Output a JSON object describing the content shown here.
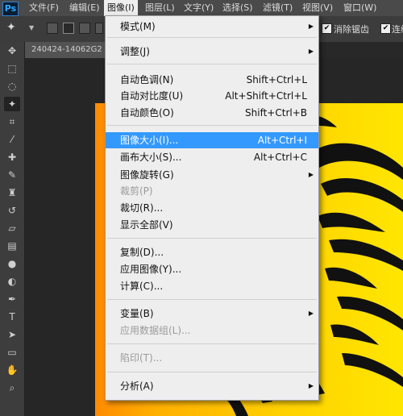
{
  "app": {
    "logo": "Ps"
  },
  "menubar": {
    "items": [
      {
        "label": "文件(F)"
      },
      {
        "label": "编辑(E)"
      },
      {
        "label": "图像(I)"
      },
      {
        "label": "图层(L)"
      },
      {
        "label": "文字(Y)"
      },
      {
        "label": "选择(S)"
      },
      {
        "label": "滤镜(T)"
      },
      {
        "label": "视图(V)"
      },
      {
        "label": "窗口(W)"
      }
    ],
    "active_index": 2
  },
  "options_bar": {
    "antialias_label": "消除锯齿",
    "antialias_checked": true,
    "contiguous_label": "连续",
    "contiguous_checked": true,
    "check_mark": "✔"
  },
  "document": {
    "tab_label": "240424-14062G2"
  },
  "image_menu": {
    "items": [
      {
        "label": "模式(M)",
        "shortcut": "",
        "submenu": true,
        "disabled": false
      },
      {
        "sep": true
      },
      {
        "label": "调整(J)",
        "shortcut": "",
        "submenu": true,
        "disabled": false
      },
      {
        "sep": true
      },
      {
        "label": "自动色调(N)",
        "shortcut": "Shift+Ctrl+L",
        "submenu": false,
        "disabled": false
      },
      {
        "label": "自动对比度(U)",
        "shortcut": "Alt+Shift+Ctrl+L",
        "submenu": false,
        "disabled": false
      },
      {
        "label": "自动颜色(O)",
        "shortcut": "Shift+Ctrl+B",
        "submenu": false,
        "disabled": false
      },
      {
        "sep": true
      },
      {
        "label": "图像大小(I)...",
        "shortcut": "Alt+Ctrl+I",
        "submenu": false,
        "disabled": false,
        "highlighted": true
      },
      {
        "label": "画布大小(S)...",
        "shortcut": "Alt+Ctrl+C",
        "submenu": false,
        "disabled": false
      },
      {
        "label": "图像旋转(G)",
        "shortcut": "",
        "submenu": true,
        "disabled": false
      },
      {
        "label": "裁剪(P)",
        "shortcut": "",
        "submenu": false,
        "disabled": true
      },
      {
        "label": "裁切(R)...",
        "shortcut": "",
        "submenu": false,
        "disabled": false
      },
      {
        "label": "显示全部(V)",
        "shortcut": "",
        "submenu": false,
        "disabled": false
      },
      {
        "sep": true
      },
      {
        "label": "复制(D)...",
        "shortcut": "",
        "submenu": false,
        "disabled": false
      },
      {
        "label": "应用图像(Y)...",
        "shortcut": "",
        "submenu": false,
        "disabled": false
      },
      {
        "label": "计算(C)...",
        "shortcut": "",
        "submenu": false,
        "disabled": false
      },
      {
        "sep": true
      },
      {
        "label": "变量(B)",
        "shortcut": "",
        "submenu": true,
        "disabled": false
      },
      {
        "label": "应用数据组(L)...",
        "shortcut": "",
        "submenu": false,
        "disabled": true
      },
      {
        "sep": true
      },
      {
        "label": "陷印(T)...",
        "shortcut": "",
        "submenu": false,
        "disabled": true
      },
      {
        "sep": true
      },
      {
        "label": "分析(A)",
        "shortcut": "",
        "submenu": true,
        "disabled": false
      }
    ]
  },
  "colors": {
    "highlight": "#3399ff",
    "menu_bg": "#eeeeee",
    "disabled_text": "#9a9a9a",
    "artwork_gradient_start": "#ff8a00",
    "artwork_gradient_end": "#ffe600"
  }
}
